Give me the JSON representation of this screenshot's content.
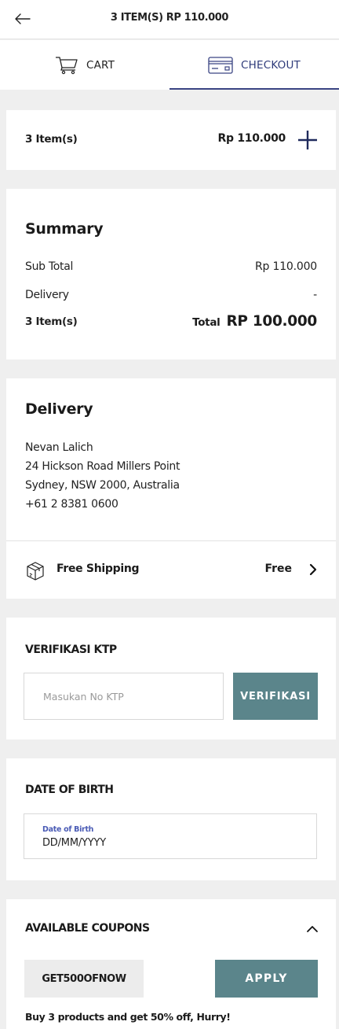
{
  "header": {
    "title": "3 ITEM(S) RP 110.000",
    "back_icon": "arrow-left-icon"
  },
  "tabs": [
    {
      "label": "CART",
      "icon": "cart-icon",
      "active": false
    },
    {
      "label": "CHECKOUT",
      "icon": "credit-card-icon",
      "active": true
    }
  ],
  "items_bar": {
    "label": "3 Item(s)",
    "price": "Rp 110.000",
    "expand_icon": "plus-icon"
  },
  "summary": {
    "title": "Summary",
    "subtotal_label": "Sub Total",
    "subtotal_value": "Rp 110.000",
    "delivery_label": "Delivery",
    "delivery_value": "-",
    "items_label": "3 Item(s)",
    "total_label": "Total",
    "total_value": "RP 100.000"
  },
  "delivery": {
    "title": "Delivery",
    "name": "Nevan Lalich",
    "address_line1": "24 Hickson Road Millers Point",
    "address_line2": "Sydney, NSW 2000, Australia",
    "phone": "+61 2 8381 0600",
    "shipping_method": "Free Shipping",
    "shipping_cost": "Free",
    "shipping_icon": "package-box-icon"
  },
  "ktp": {
    "title": "VERIFIKASI KTP",
    "placeholder": "Masukan No KTP",
    "value": "",
    "button_label": "VERIFIKASI"
  },
  "dob": {
    "title": "DATE OF BIRTH",
    "field_label": "Date of Birth",
    "value": "DD/MM/YYYY"
  },
  "coupons": {
    "title": "AVAILABLE COUPONS",
    "code": "GET500OFNOW",
    "apply_label": "APPLY",
    "description": "Buy 3 products and get 50% off, Hurry!"
  },
  "colors": {
    "accent_navy": "#3a4483",
    "button_teal": "#5b858b",
    "label_blue": "#4a5bb5",
    "background": "#efefef"
  }
}
